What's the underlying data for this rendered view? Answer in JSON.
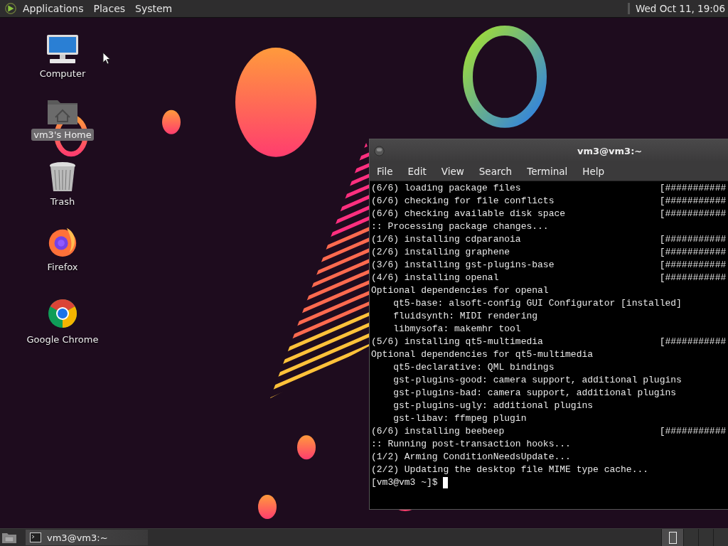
{
  "top_panel": {
    "menus": [
      "Applications",
      "Places",
      "System"
    ],
    "clock": "Wed Oct 11, 19:06"
  },
  "desktop": {
    "icons": [
      {
        "kind": "computer",
        "label": "Computer",
        "selected": false
      },
      {
        "kind": "home",
        "label": "vm3's Home",
        "selected": true
      },
      {
        "kind": "trash",
        "label": "Trash",
        "selected": false
      },
      {
        "kind": "firefox",
        "label": "Firefox",
        "selected": false
      },
      {
        "kind": "chrome",
        "label": "Google Chrome",
        "selected": false
      }
    ]
  },
  "terminal": {
    "title": "vm3@vm3:~",
    "menus": [
      "File",
      "Edit",
      "View",
      "Search",
      "Terminal",
      "Help"
    ],
    "lines": [
      {
        "text": "(6/6) loading package files",
        "progress": "[###########"
      },
      {
        "text": "(6/6) checking for file conflicts",
        "progress": "[###########"
      },
      {
        "text": "(6/6) checking available disk space",
        "progress": "[###########"
      },
      {
        "text": ":: Processing package changes..."
      },
      {
        "text": "(1/6) installing cdparanoia",
        "progress": "[###########"
      },
      {
        "text": "(2/6) installing graphene",
        "progress": "[###########"
      },
      {
        "text": "(3/6) installing gst-plugins-base",
        "progress": "[###########"
      },
      {
        "text": "(4/6) installing openal",
        "progress": "[###########"
      },
      {
        "text": "Optional dependencies for openal"
      },
      {
        "text": "    qt5-base: alsoft-config GUI Configurator [installed]"
      },
      {
        "text": "    fluidsynth: MIDI rendering"
      },
      {
        "text": "    libmysofa: makemhr tool"
      },
      {
        "text": "(5/6) installing qt5-multimedia",
        "progress": "[###########"
      },
      {
        "text": "Optional dependencies for qt5-multimedia"
      },
      {
        "text": "    qt5-declarative: QML bindings"
      },
      {
        "text": "    gst-plugins-good: camera support, additional plugins"
      },
      {
        "text": "    gst-plugins-bad: camera support, additional plugins"
      },
      {
        "text": "    gst-plugins-ugly: additional plugins"
      },
      {
        "text": "    gst-libav: ffmpeg plugin"
      },
      {
        "text": "(6/6) installing beebeep",
        "progress": "[###########"
      },
      {
        "text": ":: Running post-transaction hooks..."
      },
      {
        "text": "(1/2) Arming ConditionNeedsUpdate..."
      },
      {
        "text": "(2/2) Updating the desktop file MIME type cache..."
      }
    ],
    "prompt": "[vm3@vm3 ~]$"
  },
  "bottom_panel": {
    "tasks": [
      {
        "title": "vm3@vm3:~",
        "selected": false
      }
    ],
    "workspaces": [
      {
        "selected": true
      },
      {
        "selected": false
      },
      {
        "selected": false
      },
      {
        "selected": false
      }
    ]
  }
}
